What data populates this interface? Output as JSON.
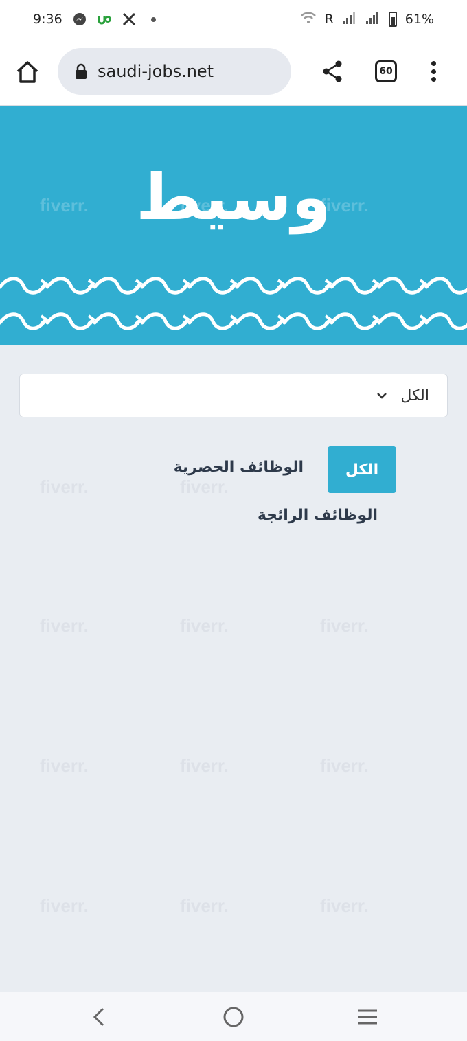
{
  "status_bar": {
    "time": "9:36",
    "notifications": [
      "messenger-icon",
      "upwork-icon",
      "x-icon",
      "dot-icon"
    ],
    "signal_label": "R",
    "battery": "61%"
  },
  "browser": {
    "url": "saudi-jobs.net",
    "tab_count": "60"
  },
  "hero": {
    "logo": "وسيط",
    "background_color": "#31aed1"
  },
  "watermark_text": "fiverr.",
  "filter": {
    "select_value": "الكل",
    "buttons": {
      "all": "الكل",
      "exclusive": "الوظائف الحصرية",
      "trending": "الوظائف الرائجة"
    }
  },
  "accent_color": "#31aed1"
}
